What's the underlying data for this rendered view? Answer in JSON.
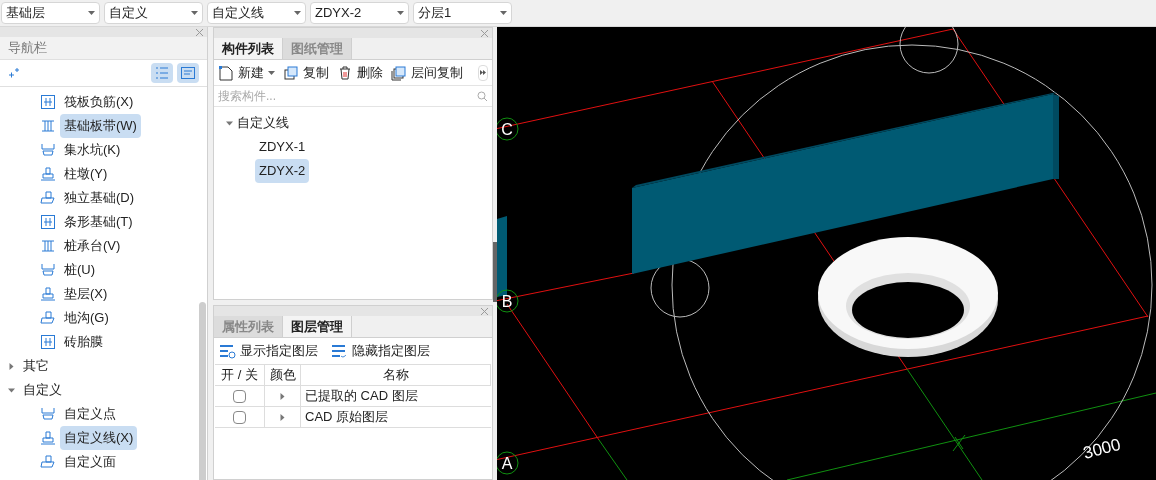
{
  "toolbar": {
    "dropdowns": [
      {
        "value": "基础层"
      },
      {
        "value": "自定义"
      },
      {
        "value": "自定义线"
      },
      {
        "value": "ZDYX-2"
      },
      {
        "value": "分层1"
      }
    ]
  },
  "navigator": {
    "title": "导航栏",
    "view_modes": [
      {
        "selected": true
      },
      {
        "selected": true
      }
    ],
    "tree": [
      {
        "children": [
          {
            "label": "筏板负筋(X)",
            "selected": false
          },
          {
            "label": "基础板带(W)",
            "selected": true
          },
          {
            "label": "集水坑(K)",
            "selected": false
          },
          {
            "label": "柱墩(Y)",
            "selected": false
          },
          {
            "label": "独立基础(D)",
            "selected": false
          },
          {
            "label": "条形基础(T)",
            "selected": false
          },
          {
            "label": "桩承台(V)",
            "selected": false
          },
          {
            "label": "桩(U)",
            "selected": false
          },
          {
            "label": "垫层(X)",
            "selected": false
          },
          {
            "label": "地沟(G)",
            "selected": false
          },
          {
            "label": "砖胎膜",
            "selected": false
          }
        ]
      },
      {
        "label": "其它",
        "expanded": false
      },
      {
        "label": "自定义",
        "expanded": true,
        "children": [
          {
            "label": "自定义点",
            "selected": false
          },
          {
            "label": "自定义线(X)",
            "selected": true
          },
          {
            "label": "自定义面",
            "selected": false
          }
        ]
      }
    ]
  },
  "component_panel": {
    "tabs": [
      {
        "label": "构件列表",
        "selected": true
      },
      {
        "label": "图纸管理",
        "selected": false
      }
    ],
    "actions": [
      {
        "label": "新建",
        "kind": "new"
      },
      {
        "label": "复制",
        "kind": "copy"
      },
      {
        "label": "删除",
        "kind": "delete"
      },
      {
        "label": "层间复制",
        "kind": "floor_copy"
      }
    ],
    "search": {
      "placeholder": "搜索构件..."
    },
    "tree": [
      {
        "label": "自定义线",
        "expanded": true,
        "children": [
          {
            "label": "ZDYX-1",
            "selected": false
          },
          {
            "label": "ZDYX-2",
            "selected": true
          }
        ]
      }
    ]
  },
  "layer_panel": {
    "tabs": [
      {
        "label": "属性列表",
        "selected": false
      },
      {
        "label": "图层管理",
        "selected": true
      }
    ],
    "actions": [
      {
        "label": "显示指定图层",
        "kind": "show"
      },
      {
        "label": "隐藏指定图层",
        "kind": "hide"
      }
    ],
    "columns": [
      "开 / 关",
      "颜色",
      "名称"
    ],
    "rows": [
      {
        "checked": false,
        "name": "已提取的 CAD 图层"
      },
      {
        "checked": false,
        "name": "CAD 原始图层"
      }
    ]
  },
  "viewport": {
    "axes": [
      "C",
      "B",
      "A"
    ],
    "dimension": "3000"
  }
}
